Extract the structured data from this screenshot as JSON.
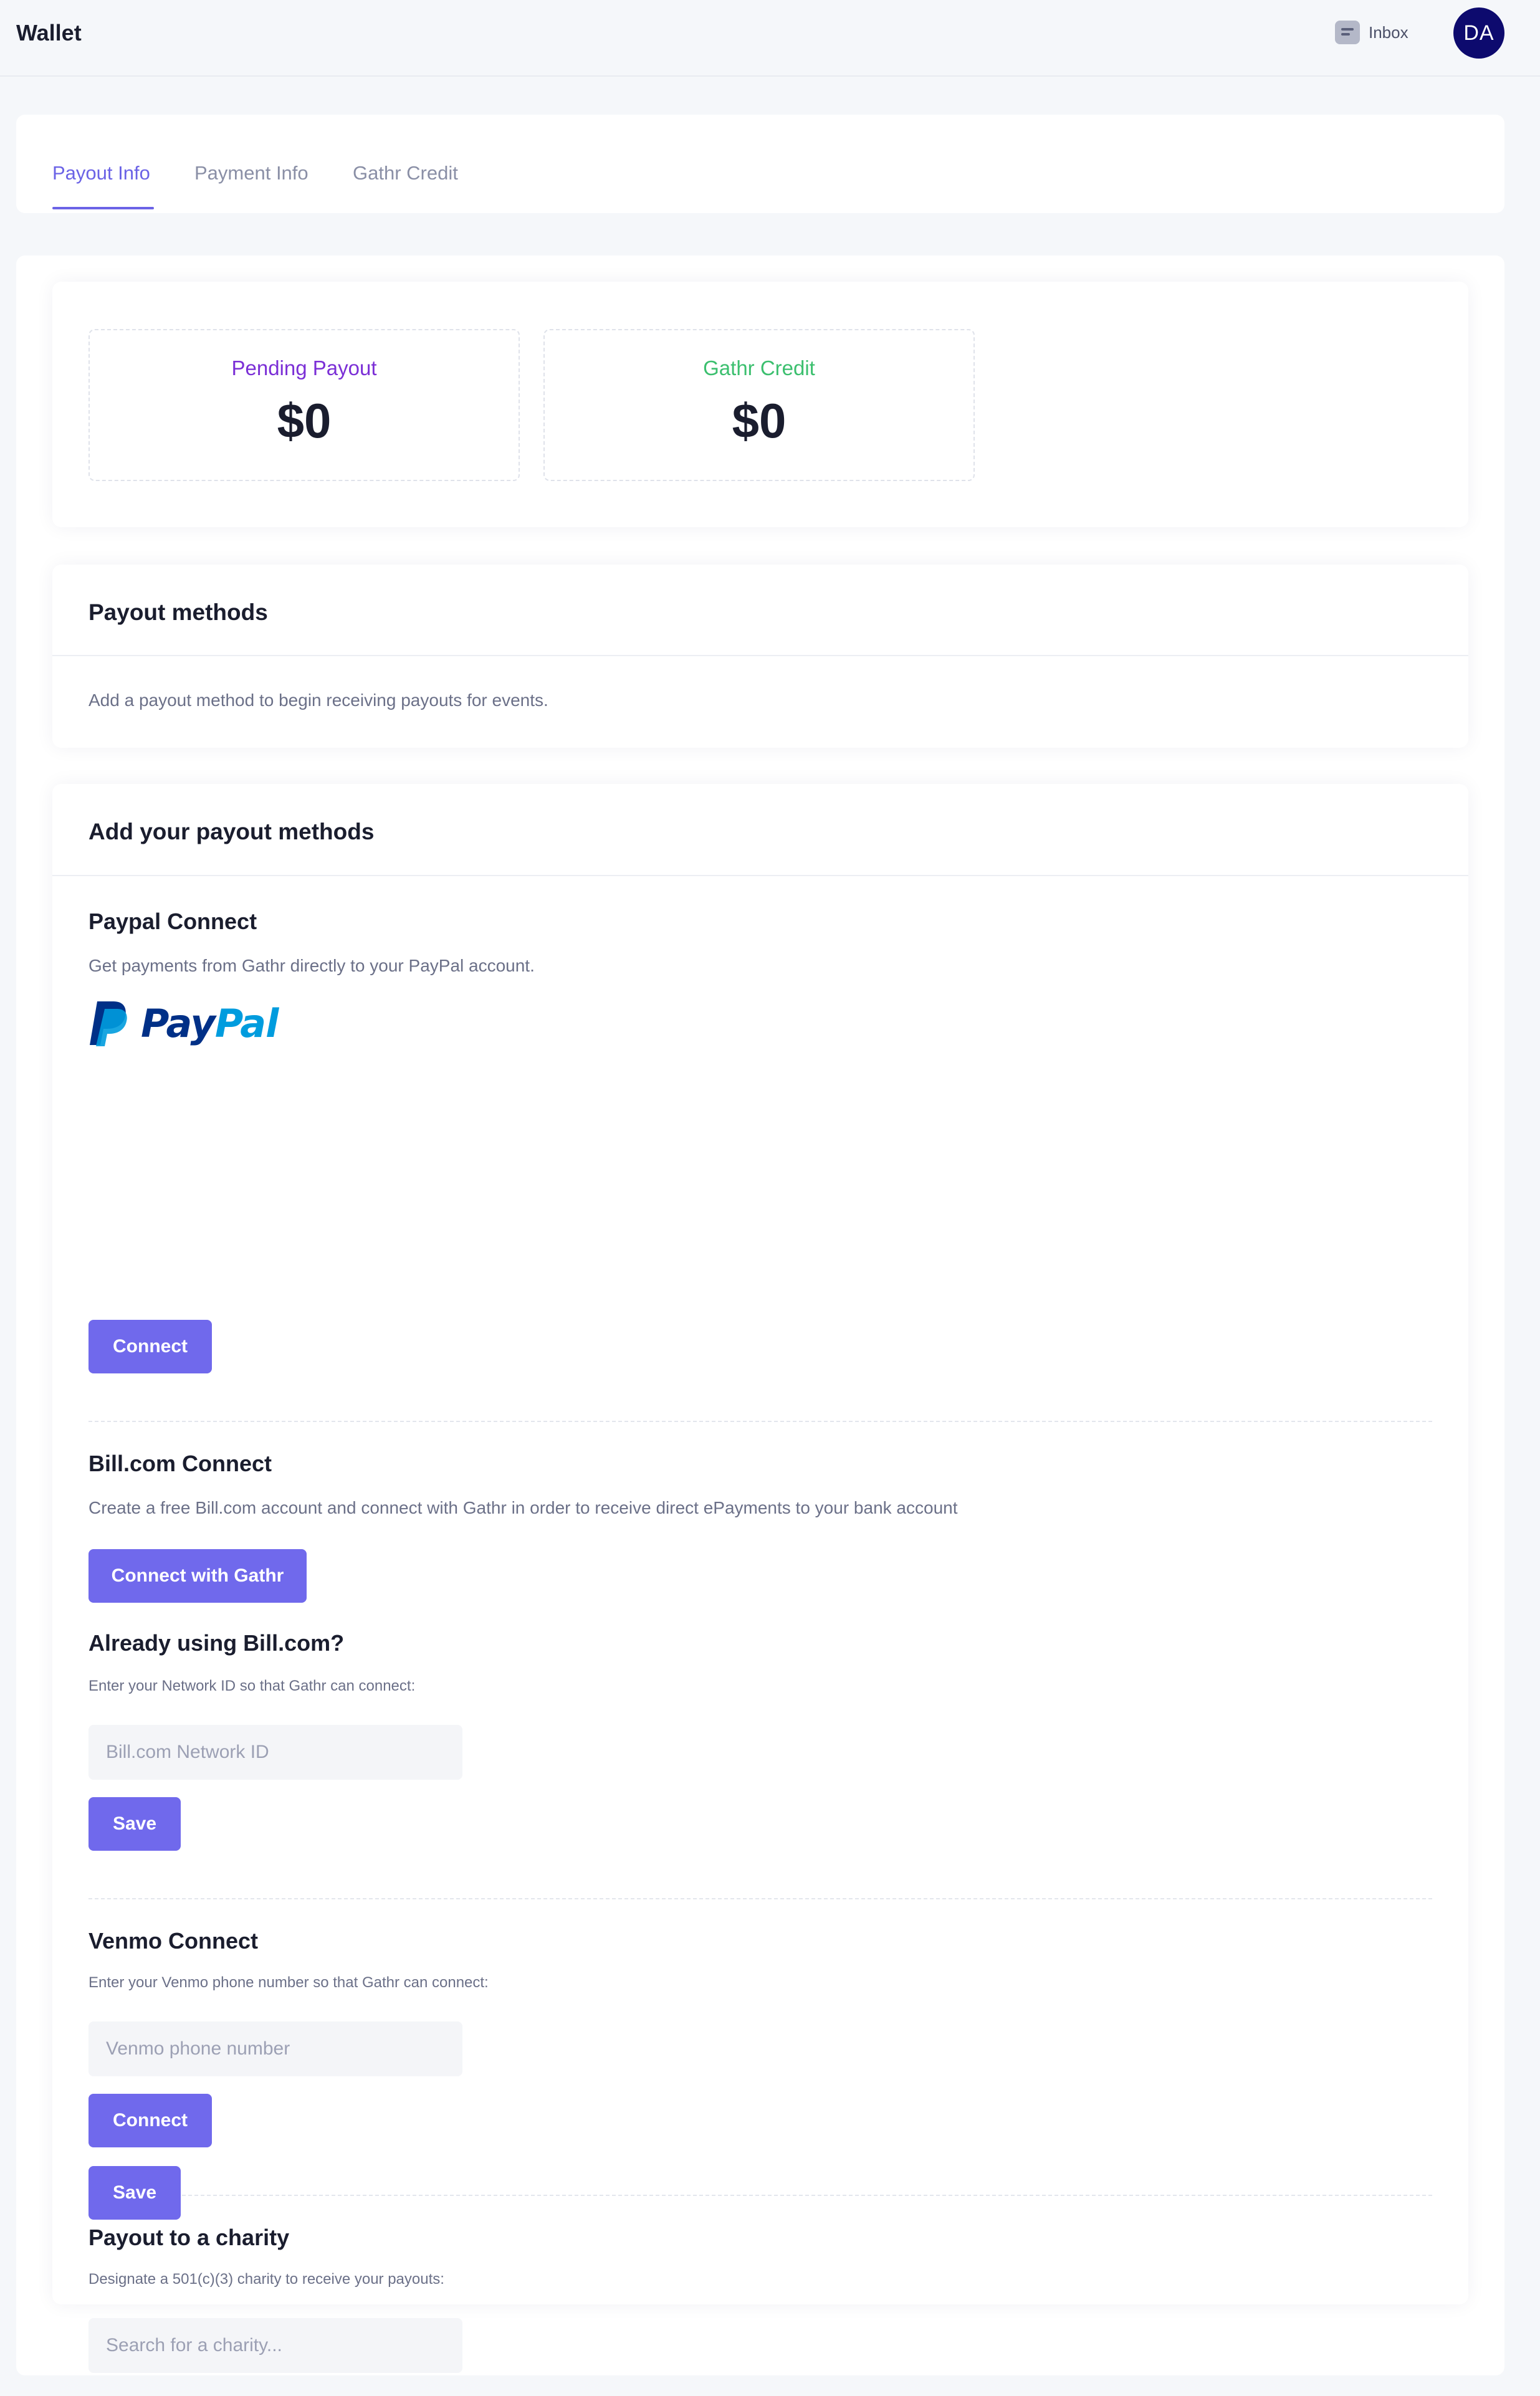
{
  "header": {
    "title": "Wallet",
    "inbox_label": "Inbox",
    "avatar_initials": "DA"
  },
  "tabs": [
    {
      "label": "Payout Info",
      "active": true
    },
    {
      "label": "Payment Info",
      "active": false
    },
    {
      "label": "Gathr Credit",
      "active": false
    }
  ],
  "balances": {
    "pending_label": "Pending Payout",
    "pending_value": "$0",
    "credit_label": "Gathr Credit",
    "credit_value": "$0"
  },
  "payout_methods": {
    "title": "Payout methods",
    "empty_text": "Add a payout method to begin receiving payouts for events."
  },
  "add_methods": {
    "title": "Add your payout methods",
    "paypal": {
      "title": "Paypal Connect",
      "description": "Get payments from Gathr directly to your PayPal account.",
      "logo_text_pay": "Pay",
      "logo_text_pal": "Pal",
      "button": "Connect"
    },
    "billcom": {
      "title": "Bill.com Connect",
      "description": "Create a free Bill.com account and connect with Gathr in order to receive direct ePayments to your bank account",
      "button": "Connect with Gathr",
      "existing_title": "Already using Bill.com?",
      "existing_help": "Enter your Network ID so that Gathr can connect:",
      "input_placeholder": "Bill.com Network ID",
      "input_value": "",
      "save_button": "Save"
    },
    "venmo": {
      "title": "Venmo Connect",
      "help": "Enter your Venmo phone number so that Gathr can connect:",
      "input_placeholder": "Venmo phone number",
      "input_value": "",
      "button": "Connect"
    },
    "charity": {
      "title": "Payout to a charity",
      "help": "Designate a 501(c)(3) charity to receive your payouts:",
      "input_placeholder": "Search for a charity...",
      "input_value": "",
      "save_button": "Save"
    }
  },
  "colors": {
    "accent": "#6b63e6",
    "button": "#7069ec",
    "pending_label": "#7b2fd6",
    "credit_label": "#3bbf6e",
    "avatar_bg": "#0d0a6e",
    "paypal_dark": "#003087",
    "paypal_light": "#009cde"
  }
}
